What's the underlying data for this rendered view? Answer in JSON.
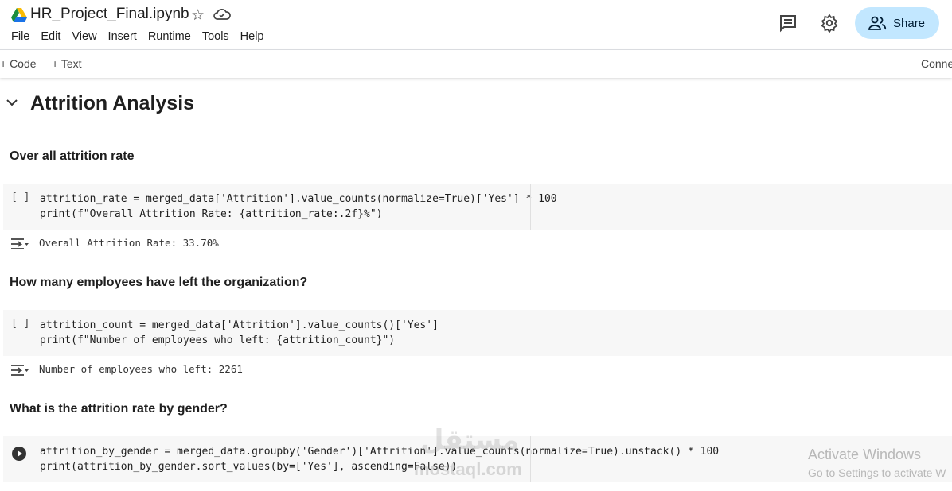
{
  "header": {
    "title": "HR_Project_Final.ipynb",
    "menu": [
      "File",
      "Edit",
      "View",
      "Insert",
      "Runtime",
      "Tools",
      "Help"
    ],
    "share_label": "Share"
  },
  "toolbar": {
    "code_label": "+ Code",
    "text_label": "+ Text",
    "connect_label": "Conne"
  },
  "section_title": "Attrition Analysis",
  "cells": [
    {
      "heading": "Over all attrition rate",
      "run_state": "[ ]",
      "line1": "attrition_rate = merged_data['Attrition'].value_counts(normalize=True)['Yes'] * 100",
      "line2": "print(f\"Overall Attrition Rate: {attrition_rate:.2f}%\")",
      "output": "Overall Attrition Rate: 33.70%"
    },
    {
      "heading": "How many employees have left the organization?",
      "run_state": "[ ]",
      "line1": "attrition_count = merged_data['Attrition'].value_counts()['Yes']",
      "line2": "print(f\"Number of employees who left: {attrition_count}\")",
      "output": "Number of employees who left: 2261"
    },
    {
      "heading": "What is the attrition rate by gender?",
      "run_state": "run",
      "line1": "attrition_by_gender = merged_data.groupby('Gender')['Attrition'].value_counts(normalize=True).unstack() * 100",
      "line2": "print(attrition_by_gender.sort_values(by=['Yes'], ascending=False))"
    }
  ],
  "watermark": {
    "line1": "Activate Windows",
    "line2": "Go to Settings to activate W",
    "mostaql": "mostaql.com",
    "arabic": "مستقل"
  },
  "colors": {
    "share_bg": "#c2e7ff",
    "cell_bg": "#f7f7f7",
    "string": "#a31515",
    "keyword": "#0000ff",
    "number": "#098658",
    "function": "#795e26"
  }
}
